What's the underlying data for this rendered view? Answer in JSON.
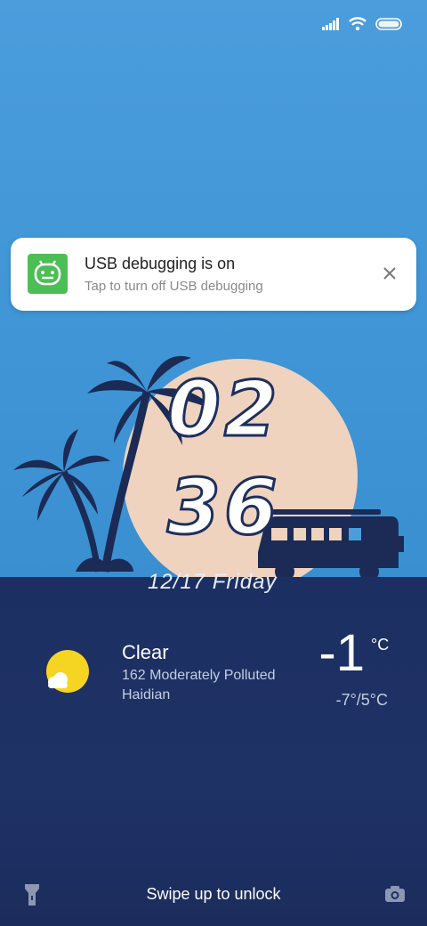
{
  "notification": {
    "title": "USB debugging is on",
    "subtitle": "Tap to turn off USB debugging",
    "icon": "android-debug-icon"
  },
  "clock": {
    "hour": "02",
    "minute": "36",
    "date": "12/17",
    "day": "Friday"
  },
  "weather": {
    "icon": "partly-sunny-icon",
    "condition": "Clear",
    "aqi": "162  Moderately Polluted",
    "location": "Haidian",
    "temperature": "-1",
    "unit": "°C",
    "range": "-7°/5°C"
  },
  "lockscreen": {
    "hint": "Swipe up to unlock"
  },
  "colors": {
    "sky": "#3d95d6",
    "ground": "#1f3266",
    "moon": "#efd3bf",
    "silhouette": "#1b2b55",
    "accent_green": "#4dbd55"
  }
}
